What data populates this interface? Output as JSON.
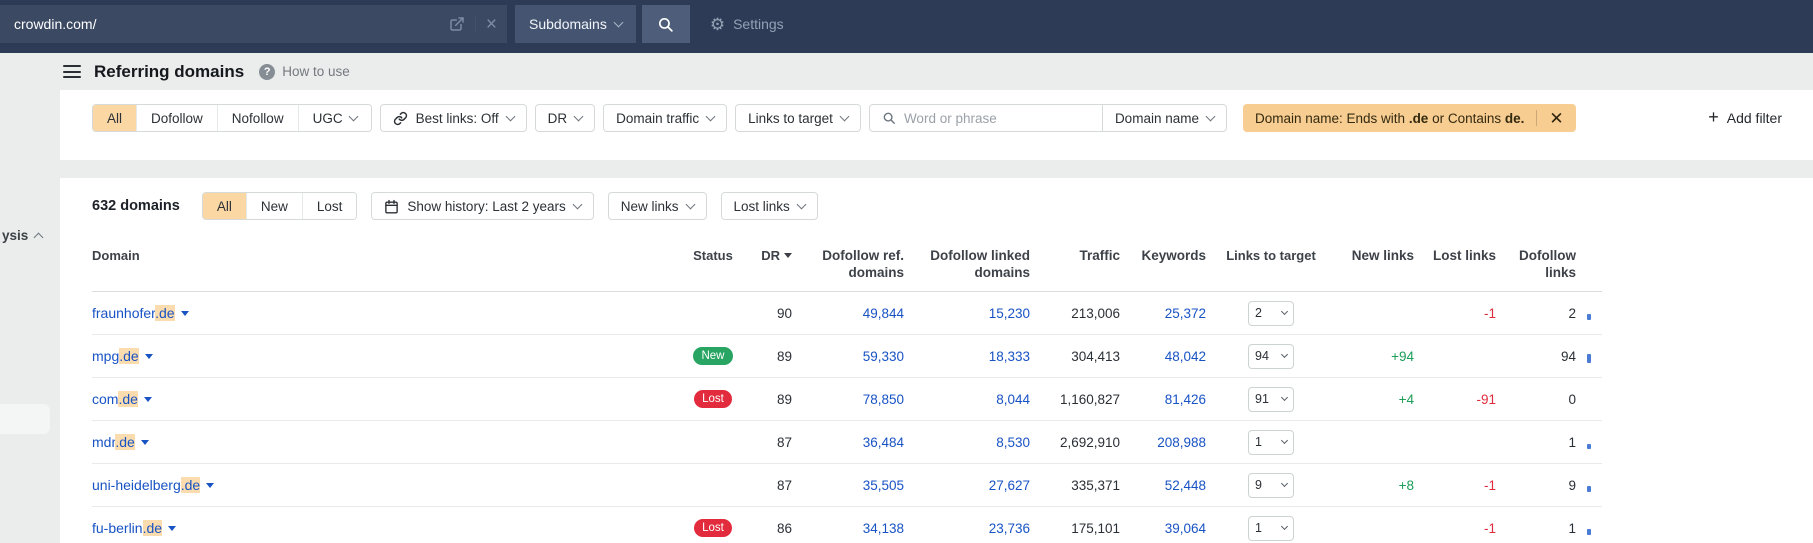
{
  "colors": {
    "topbar_bg": "#2d3b56",
    "accent_chip": "#f7cd92",
    "active_tab": "#fbd7a4",
    "text_highlight": "#fbdcae",
    "link_blue": "#1853c4",
    "green": "#1b9e57",
    "red": "#e02b3c",
    "badge_new": "#28a562",
    "badge_lost": "#e22b3c"
  },
  "topbar": {
    "target_value": "crowdin.com/",
    "mode_label": "Subdomains",
    "settings_label": "Settings"
  },
  "sidebar": {
    "clipped_item_label": "ysis"
  },
  "header": {
    "title": "Referring domains",
    "help_label": "How to use"
  },
  "filters": {
    "link_type_options": [
      "All",
      "Dofollow",
      "Nofollow",
      "UGC"
    ],
    "link_type_active": "All",
    "best_links_label": "Best links: Off",
    "dr_label": "DR",
    "domain_traffic_label": "Domain traffic",
    "links_to_target_label": "Links to target",
    "search_placeholder": "Word or phrase",
    "search_mode_label": "Domain name",
    "chip": {
      "prefix": "Domain name: Ends with ",
      "bold1": ".de",
      "middle": " or Contains ",
      "bold2": "de."
    },
    "add_filter_label": "Add filter"
  },
  "table_controls": {
    "count_label": "632 domains",
    "status_tabs": [
      "All",
      "New",
      "Lost"
    ],
    "status_active": "All",
    "show_history_label": "Show history: Last 2 years",
    "new_links_label": "New links",
    "lost_links_label": "Lost links"
  },
  "table": {
    "headers": {
      "domain": "Domain",
      "status": "Status",
      "dr": "DR",
      "dofollow_ref": "Dofollow ref.\ndomains",
      "dofollow_linked": "Dofollow linked\ndomains",
      "traffic": "Traffic",
      "keywords": "Keywords",
      "links_to_target": "Links to target",
      "new_links": "New links",
      "lost_links": "Lost links",
      "dofollow_links": "Dofollow\nlinks"
    },
    "rows": [
      {
        "domain_prefix": "fraunhofer",
        "domain_highlight": ".de",
        "status": "",
        "dr": "90",
        "dofollow_ref": "49,844",
        "dofollow_linked": "15,230",
        "traffic": "213,006",
        "keywords": "25,372",
        "links_select": "2",
        "new_links": "",
        "lost_links": "-1",
        "dofollow_links": "2",
        "spark": 6
      },
      {
        "domain_prefix": "mpg",
        "domain_highlight": ".de",
        "status": "New",
        "dr": "89",
        "dofollow_ref": "59,330",
        "dofollow_linked": "18,333",
        "traffic": "304,413",
        "keywords": "48,042",
        "links_select": "94",
        "new_links": "+94",
        "lost_links": "",
        "dofollow_links": "94",
        "spark": 9
      },
      {
        "domain_prefix": "com",
        "domain_highlight": ".de",
        "status": "Lost",
        "dr": "89",
        "dofollow_ref": "78,850",
        "dofollow_linked": "8,044",
        "traffic": "1,160,827",
        "keywords": "81,426",
        "links_select": "91",
        "new_links": "+4",
        "lost_links": "-91",
        "dofollow_links": "0",
        "spark": 0
      },
      {
        "domain_prefix": "mdr",
        "domain_highlight": ".de",
        "status": "",
        "dr": "87",
        "dofollow_ref": "36,484",
        "dofollow_linked": "8,530",
        "traffic": "2,692,910",
        "keywords": "208,988",
        "links_select": "1",
        "new_links": "",
        "lost_links": "",
        "dofollow_links": "1",
        "spark": 5
      },
      {
        "domain_prefix": "uni-heidelberg",
        "domain_highlight": ".de",
        "status": "",
        "dr": "87",
        "dofollow_ref": "35,505",
        "dofollow_linked": "27,627",
        "traffic": "335,371",
        "keywords": "52,448",
        "links_select": "9",
        "new_links": "+8",
        "lost_links": "-1",
        "dofollow_links": "9",
        "spark": 6
      },
      {
        "domain_prefix": "fu-berlin",
        "domain_highlight": ".de",
        "status": "Lost",
        "dr": "86",
        "dofollow_ref": "34,138",
        "dofollow_linked": "23,736",
        "traffic": "175,101",
        "keywords": "39,064",
        "links_select": "1",
        "new_links": "",
        "lost_links": "-1",
        "dofollow_links": "1",
        "spark": 6
      }
    ]
  }
}
